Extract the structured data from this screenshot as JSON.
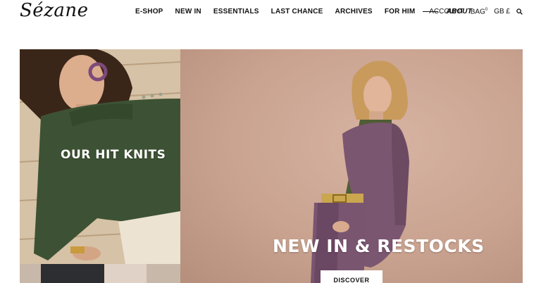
{
  "header": {
    "logo": "Sézane",
    "nav": [
      {
        "label": "E-SHOP"
      },
      {
        "label": "NEW IN"
      },
      {
        "label": "ESSENTIALS"
      },
      {
        "label": "LAST CHANCE"
      },
      {
        "label": "ARCHIVES"
      },
      {
        "label": "FOR HIM"
      },
      {
        "label": "ABOUT"
      }
    ],
    "account": "ACCOUNT",
    "bag": "BAG",
    "bag_count": "0",
    "region": "GB £",
    "search_icon": "search-icon"
  },
  "banners": {
    "left": {
      "title": "OUR HIT KNITS",
      "colors": {
        "background": "#d4c0a5",
        "sweater": "#3d5234"
      }
    },
    "right": {
      "title": "NEW IN & RESTOCKS",
      "button": "DISCOVER",
      "colors": {
        "background": "#c9a390",
        "jacket": "#7b5670"
      }
    }
  }
}
